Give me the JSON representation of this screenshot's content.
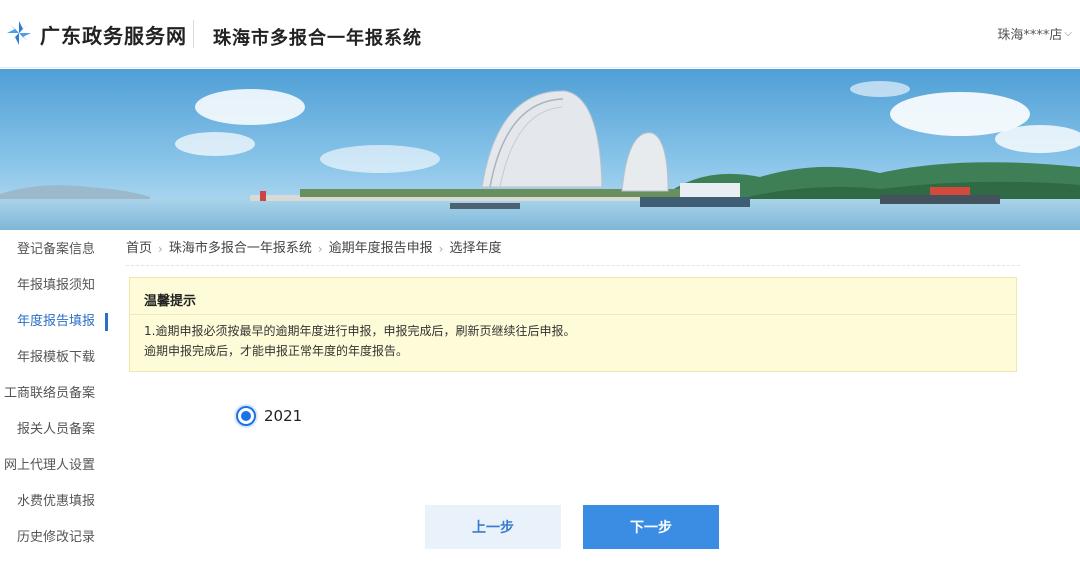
{
  "header": {
    "brand": "广东政务服务网",
    "system_title": "珠海市多报合一年报系统",
    "user_name": "珠海****店"
  },
  "sidebar": {
    "items": [
      {
        "label": "登记备案信息"
      },
      {
        "label": "年报填报须知"
      },
      {
        "label": "年度报告填报"
      },
      {
        "label": "年报模板下载"
      },
      {
        "label": "工商联络员备案"
      },
      {
        "label": "报关人员备案"
      },
      {
        "label": "网上代理人设置"
      },
      {
        "label": "水费优惠填报"
      },
      {
        "label": "历史修改记录"
      }
    ],
    "active_index": 2
  },
  "breadcrumb": [
    "首页",
    "珠海市多报合一年报系统",
    "逾期年度报告申报",
    "选择年度"
  ],
  "notice": {
    "title": "温馨提示",
    "line1": "1.逾期申报必须按最早的逾期年度进行申报，申报完成后，刷新页继续往后申报。",
    "line2": "逾期申报完成后，才能申报正常年度的年度报告。"
  },
  "year_select": {
    "options": [
      "2021"
    ],
    "selected": "2021"
  },
  "actions": {
    "prev_label": "上一步",
    "next_label": "下一步"
  },
  "colors": {
    "accent": "#2b6fc7",
    "primary_button": "#3b8ce3",
    "secondary_button_bg": "#e9f2fb",
    "notice_bg": "#fefbd8"
  }
}
